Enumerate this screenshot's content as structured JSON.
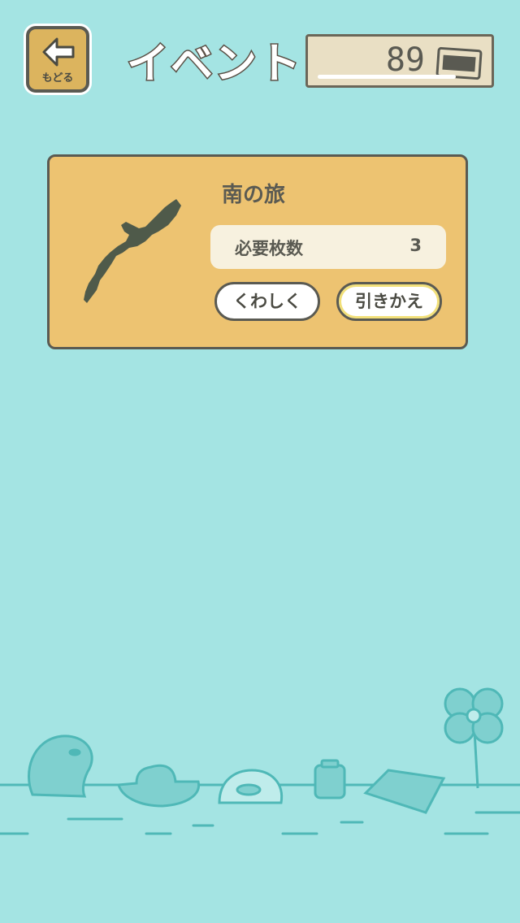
{
  "header": {
    "back_label": "もどる",
    "title": "イベント",
    "ticket_count": "89"
  },
  "event_card": {
    "title": "南の旅",
    "required_label": "必要枚数",
    "required_value": "3",
    "details_button": "くわしく",
    "exchange_button": "引きかえ"
  },
  "colors": {
    "background": "#a4e4e3",
    "card": "#edc371",
    "outline": "#5a5a52"
  },
  "icons": [
    "back-arrow-icon",
    "ticket-icon",
    "island-map-icon",
    "frog-icon",
    "hat-icon",
    "tent-icon",
    "lantern-icon",
    "mat-icon",
    "clover-icon"
  ]
}
